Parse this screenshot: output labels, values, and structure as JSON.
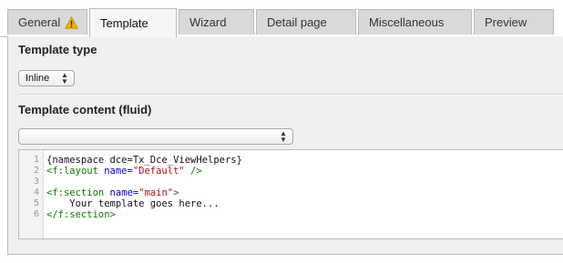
{
  "tabs": [
    {
      "label": "General",
      "active": false,
      "warning": true
    },
    {
      "label": "Template",
      "active": true
    },
    {
      "label": "Wizard",
      "active": false
    },
    {
      "label": "Detail page",
      "active": false
    },
    {
      "label": "Miscellaneous",
      "active": false
    },
    {
      "label": "Preview",
      "active": false
    }
  ],
  "template_type": {
    "title": "Template type",
    "selected": "Inline"
  },
  "template_content": {
    "title": "Template content (fluid)",
    "selected": ""
  },
  "editor": {
    "lines": [
      {
        "num": "1",
        "parts": [
          {
            "t": "{namespace dce=Tx_Dce_ViewHelpers}",
            "c": "plain"
          }
        ]
      },
      {
        "num": "2",
        "parts": [
          {
            "t": "<f:layout ",
            "c": "tag"
          },
          {
            "t": "name=",
            "c": "attr"
          },
          {
            "t": "\"Default\"",
            "c": "str"
          },
          {
            "t": " />",
            "c": "tag"
          }
        ]
      },
      {
        "num": "3",
        "parts": []
      },
      {
        "num": "4",
        "parts": [
          {
            "t": "<f:section ",
            "c": "tag"
          },
          {
            "t": "name=",
            "c": "attr"
          },
          {
            "t": "\"main\"",
            "c": "str"
          },
          {
            "t": ">",
            "c": "tag"
          }
        ]
      },
      {
        "num": "5",
        "parts": [
          {
            "t": "    Your template goes here...",
            "c": "plain"
          }
        ]
      },
      {
        "num": "6",
        "parts": [
          {
            "t": "</f:section>",
            "c": "tag"
          }
        ]
      }
    ]
  },
  "colors": {
    "tag": "#117700",
    "attr": "#0000cc",
    "string": "#aa1111",
    "warning": "#f2b600"
  },
  "icons": {
    "warning": "warning-triangle-icon",
    "select_arrows": "updown-arrows-icon"
  }
}
